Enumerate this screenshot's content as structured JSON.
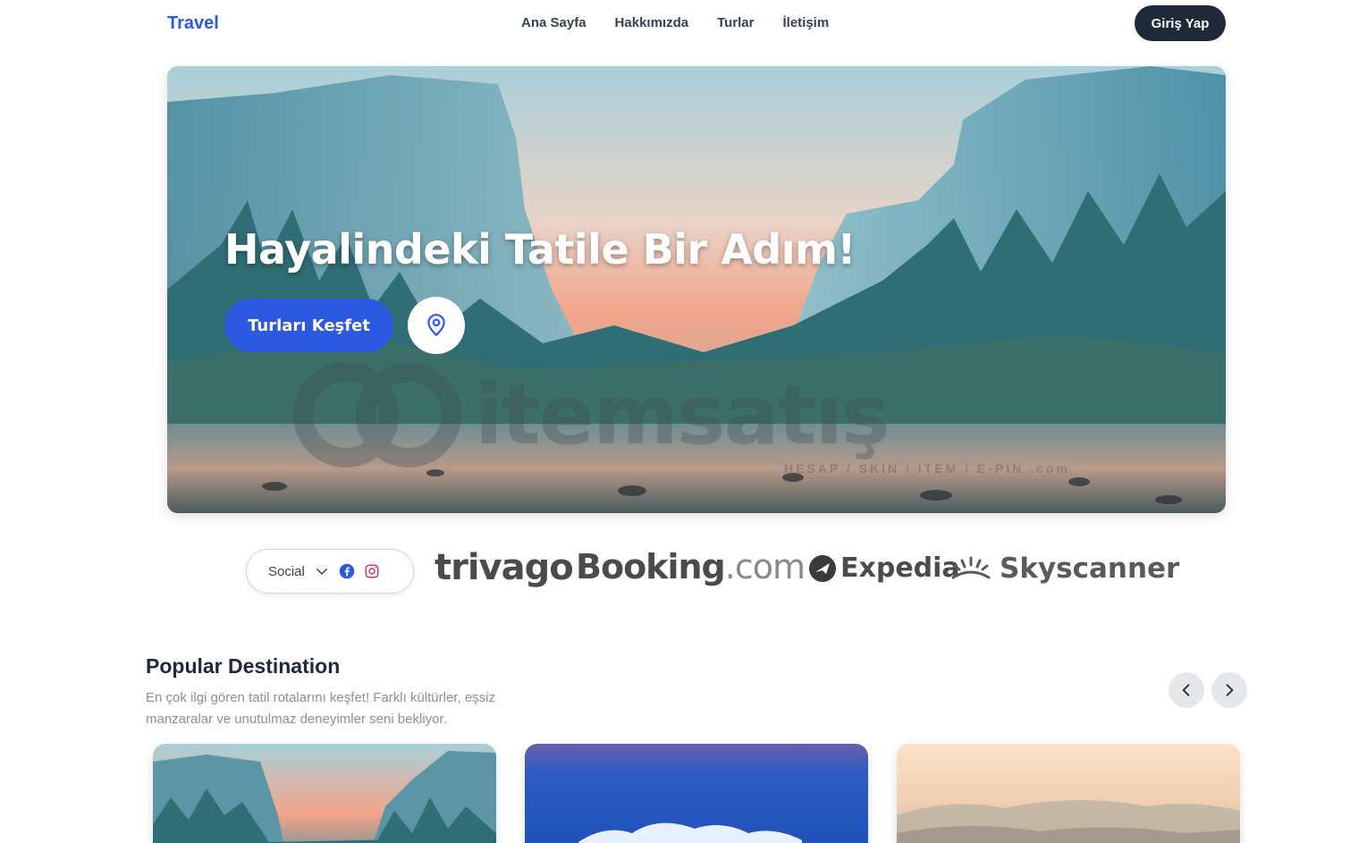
{
  "navbar": {
    "brand": "Travel",
    "links": [
      "Ana Sayfa",
      "Hakkımızda",
      "Turlar",
      "İletişim"
    ],
    "login_label": "Giriş Yap"
  },
  "hero": {
    "title": "Hayalindeki Tatile Bir Adım!",
    "cta_label": "Turları Keşfet",
    "pin_icon": "map-pin-icon",
    "watermark": {
      "text": "itemsatış",
      "sub": "HESAP / SKIN / ITEM / E-PIN .com"
    }
  },
  "partners": {
    "social_label": "Social",
    "social_icons": [
      "chevron-down-icon",
      "facebook-icon",
      "instagram-icon"
    ],
    "logos": {
      "trivago": "trivago",
      "booking_main": "Booking",
      "booking_suffix": ".com",
      "expedia": "Expedia",
      "skyscanner": "Skyscanner"
    }
  },
  "popular": {
    "title": "Popular Destination",
    "description": "En çok ilgi gören tatil rotalarını keşfet! Farklı kültürler, eşsiz manzaralar ve unutulmaz deneyimler seni bekliyor."
  },
  "colors": {
    "accent": "#2b59e0",
    "dark": "#1f2937",
    "muted": "#8b8f97",
    "instagram": "#e1306c",
    "facebook": "#2b59e0"
  }
}
